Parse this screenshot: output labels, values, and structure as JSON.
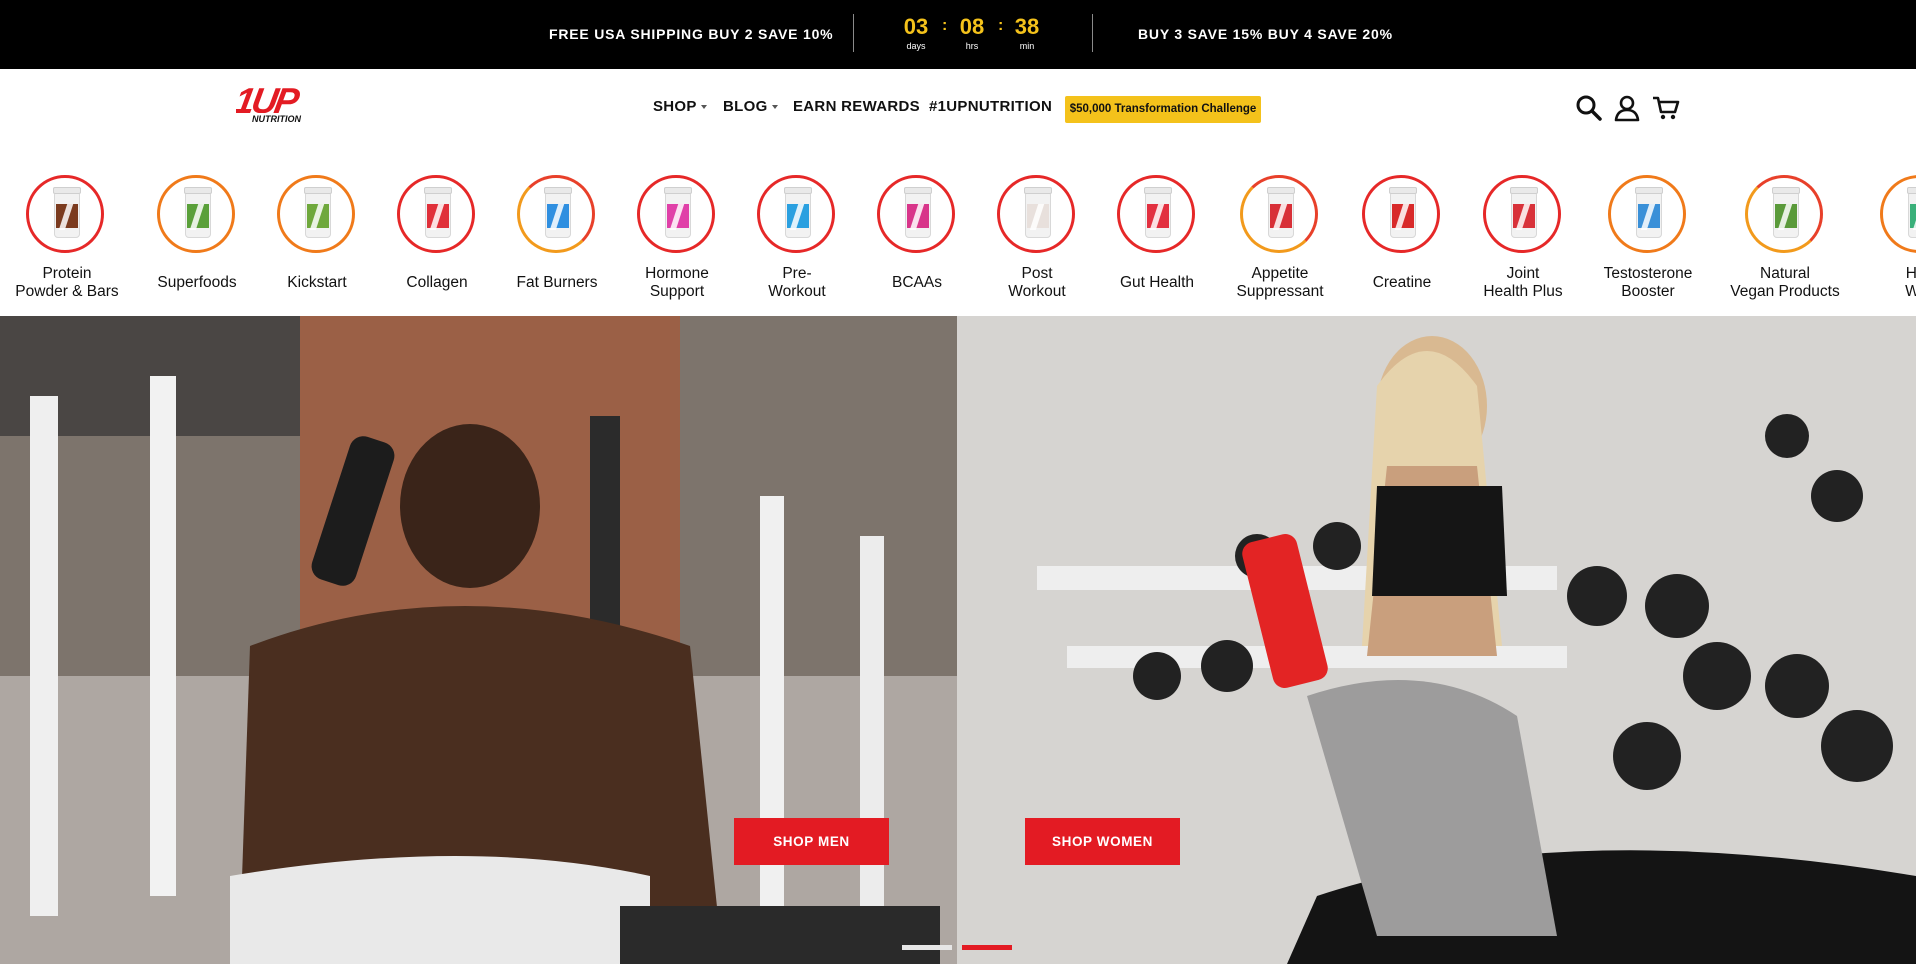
{
  "announcement": {
    "left_promo": "FREE USA SHIPPING BUY 2 SAVE 10%",
    "right_promo": "BUY 3 SAVE 15% BUY 4 SAVE 20%",
    "countdown": {
      "days": "03",
      "days_label": "days",
      "hours": "08",
      "hours_label": "hrs",
      "minutes": "38",
      "minutes_label": "min",
      "separator": ":"
    }
  },
  "header": {
    "logo_text": "1UP",
    "logo_subtext": "NUTRITION",
    "nav": {
      "shop": "SHOP",
      "blog": "BLOG",
      "earn_rewards": "EARN REWARDS",
      "hashtag": "#1UPNUTRITION"
    },
    "challenge_button": "$50,000 Transformation Challenge",
    "icons": [
      "search-icon",
      "account-icon",
      "cart-icon"
    ]
  },
  "categories": [
    {
      "label": "Protein\nPowder & Bars",
      "ring": "red",
      "tub_color": "#7b3b1f"
    },
    {
      "label": "Superfoods",
      "ring": "orange",
      "tub_color": "#5aa03a"
    },
    {
      "label": "Kickstart",
      "ring": "orange",
      "tub_color": "#6fa83c"
    },
    {
      "label": "Collagen",
      "ring": "red",
      "tub_color": "#e0303a"
    },
    {
      "label": "Fat Burners",
      "ring": "grad",
      "tub_color": "#2f8fe0"
    },
    {
      "label": "Hormone\nSupport",
      "ring": "red",
      "tub_color": "#e040a8"
    },
    {
      "label": "Pre-\nWorkout",
      "ring": "red",
      "tub_color": "#2aa0e0"
    },
    {
      "label": "BCAAs",
      "ring": "red",
      "tub_color": "#d8358a"
    },
    {
      "label": "Post\nWorkout",
      "ring": "red",
      "tub_color": "#e8e0dc"
    },
    {
      "label": "Gut Health",
      "ring": "red",
      "tub_color": "#e23040"
    },
    {
      "label": "Appetite\nSuppressant",
      "ring": "grad",
      "tub_color": "#d83038"
    },
    {
      "label": "Creatine",
      "ring": "red",
      "tub_color": "#d82a2a"
    },
    {
      "label": "Joint\nHealth Plus",
      "ring": "red",
      "tub_color": "#d8323a"
    },
    {
      "label": "Testosterone\nBooster",
      "ring": "orange",
      "tub_color": "#3a90d8"
    },
    {
      "label": "Natural\nVegan Products",
      "ring": "grad",
      "tub_color": "#5a9a3a"
    },
    {
      "label": "Hea\nWell",
      "ring": "orange",
      "tub_color": "#3ab07a"
    }
  ],
  "hero": {
    "shop_men": "SHOP MEN",
    "shop_women": "SHOP WOMEN",
    "slides": 2,
    "active_slide": 2
  },
  "colors": {
    "brand_red": "#e31b23",
    "countdown_yellow": "#f4c21b",
    "challenge_yellow": "#f4c21b"
  }
}
